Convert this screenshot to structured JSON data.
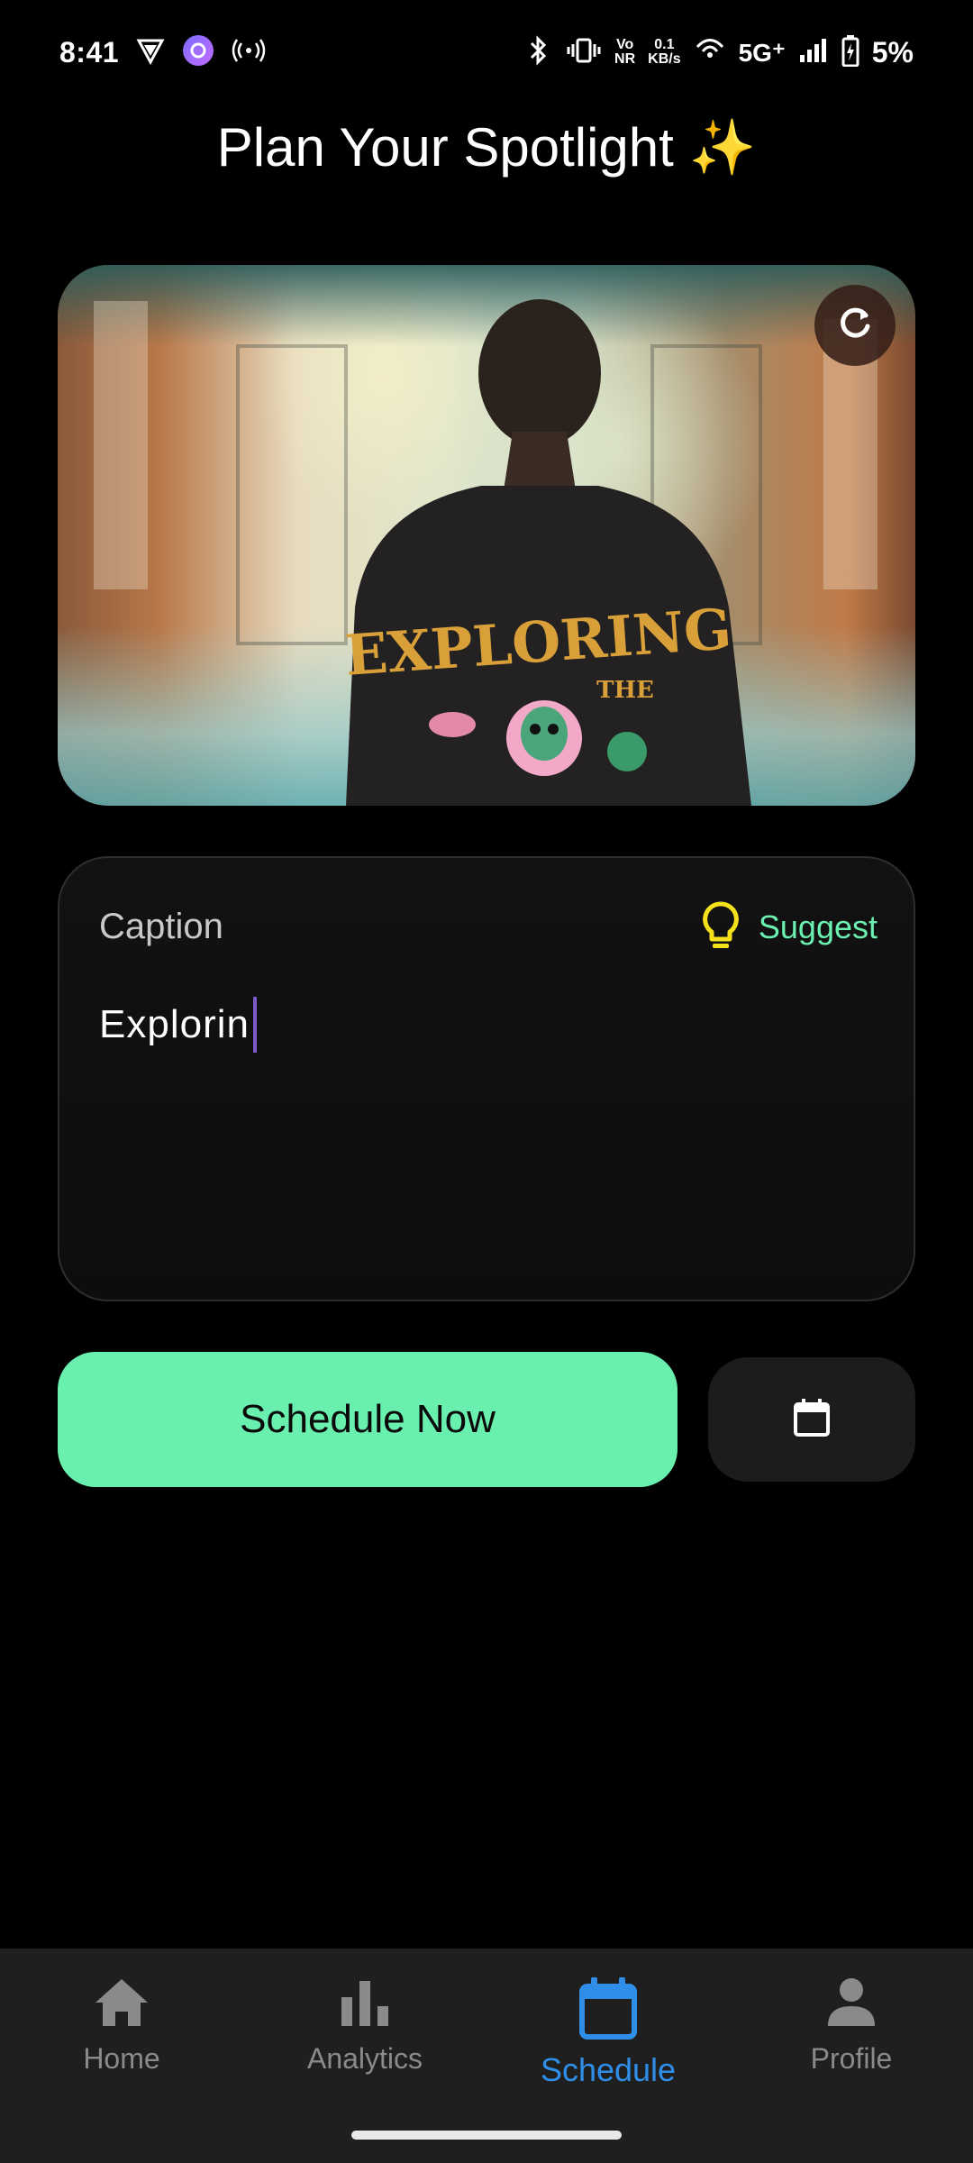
{
  "status_bar": {
    "time": "8:41",
    "speed_value": "0.1",
    "speed_unit": "KB/s",
    "vo_top": "Vo",
    "vo_bottom": "NR",
    "network": "5G⁺",
    "battery": "5%"
  },
  "page": {
    "title": "Plan Your Spotlight ✨"
  },
  "media": {
    "shirt_text": "EXPLORING",
    "shirt_subtext": "THE",
    "refresh_icon": "refresh-icon"
  },
  "caption": {
    "label": "Caption",
    "suggest_label": "Suggest",
    "value": "Explorin",
    "accent_color": "#6bf0b0",
    "bulb_color": "#f5e21b"
  },
  "actions": {
    "schedule_label": "Schedule Now",
    "schedule_color": "#69f0ae",
    "calendar_icon": "calendar-icon"
  },
  "nav": {
    "active": "Schedule",
    "active_color": "#2f8fe8",
    "items": [
      {
        "label": "Home",
        "icon": "home-icon"
      },
      {
        "label": "Analytics",
        "icon": "bar-chart-icon"
      },
      {
        "label": "Schedule",
        "icon": "calendar-icon"
      },
      {
        "label": "Profile",
        "icon": "person-icon"
      }
    ]
  }
}
